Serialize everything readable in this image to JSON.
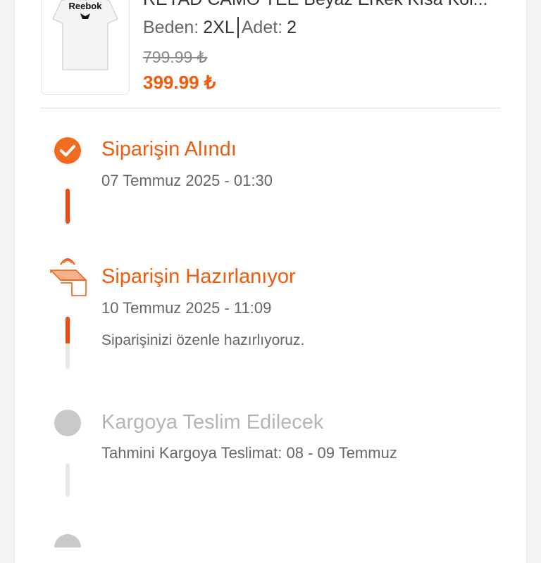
{
  "product": {
    "title": "REYAD CAMO TEE Beyaz Erkek Kısa Kol...",
    "image_brand": "Reebok",
    "size_label": "Beden:",
    "size_value": "2XL",
    "qty_label": "Adet:",
    "qty_value": "2",
    "old_price": "799.99 ₺",
    "new_price": "399.99 ₺"
  },
  "timeline": {
    "steps": [
      {
        "title": "Siparişin Alındı",
        "date": "07 Temmuz 2025 - 01:30",
        "state": "done",
        "icon": "check-circle-icon"
      },
      {
        "title": "Siparişin Hazırlanıyor",
        "date": "10 Temmuz 2025 - 11:09",
        "description": "Siparişinizi özenle hazırlıyoruz.",
        "state": "active",
        "icon": "package-icon"
      },
      {
        "title": "Kargoya Teslim Edilecek",
        "date": "Tahmini Kargoya Teslimat: 08 - 09 Temmuz",
        "state": "pending",
        "icon": "pending-dot-icon"
      }
    ]
  },
  "colors": {
    "accent": "#f25a0c",
    "done_icon": "#f26b1f",
    "pending": "#c9c9c9",
    "pending_text": "#b5b5b5",
    "bar_pending": "#e8e8e8"
  }
}
